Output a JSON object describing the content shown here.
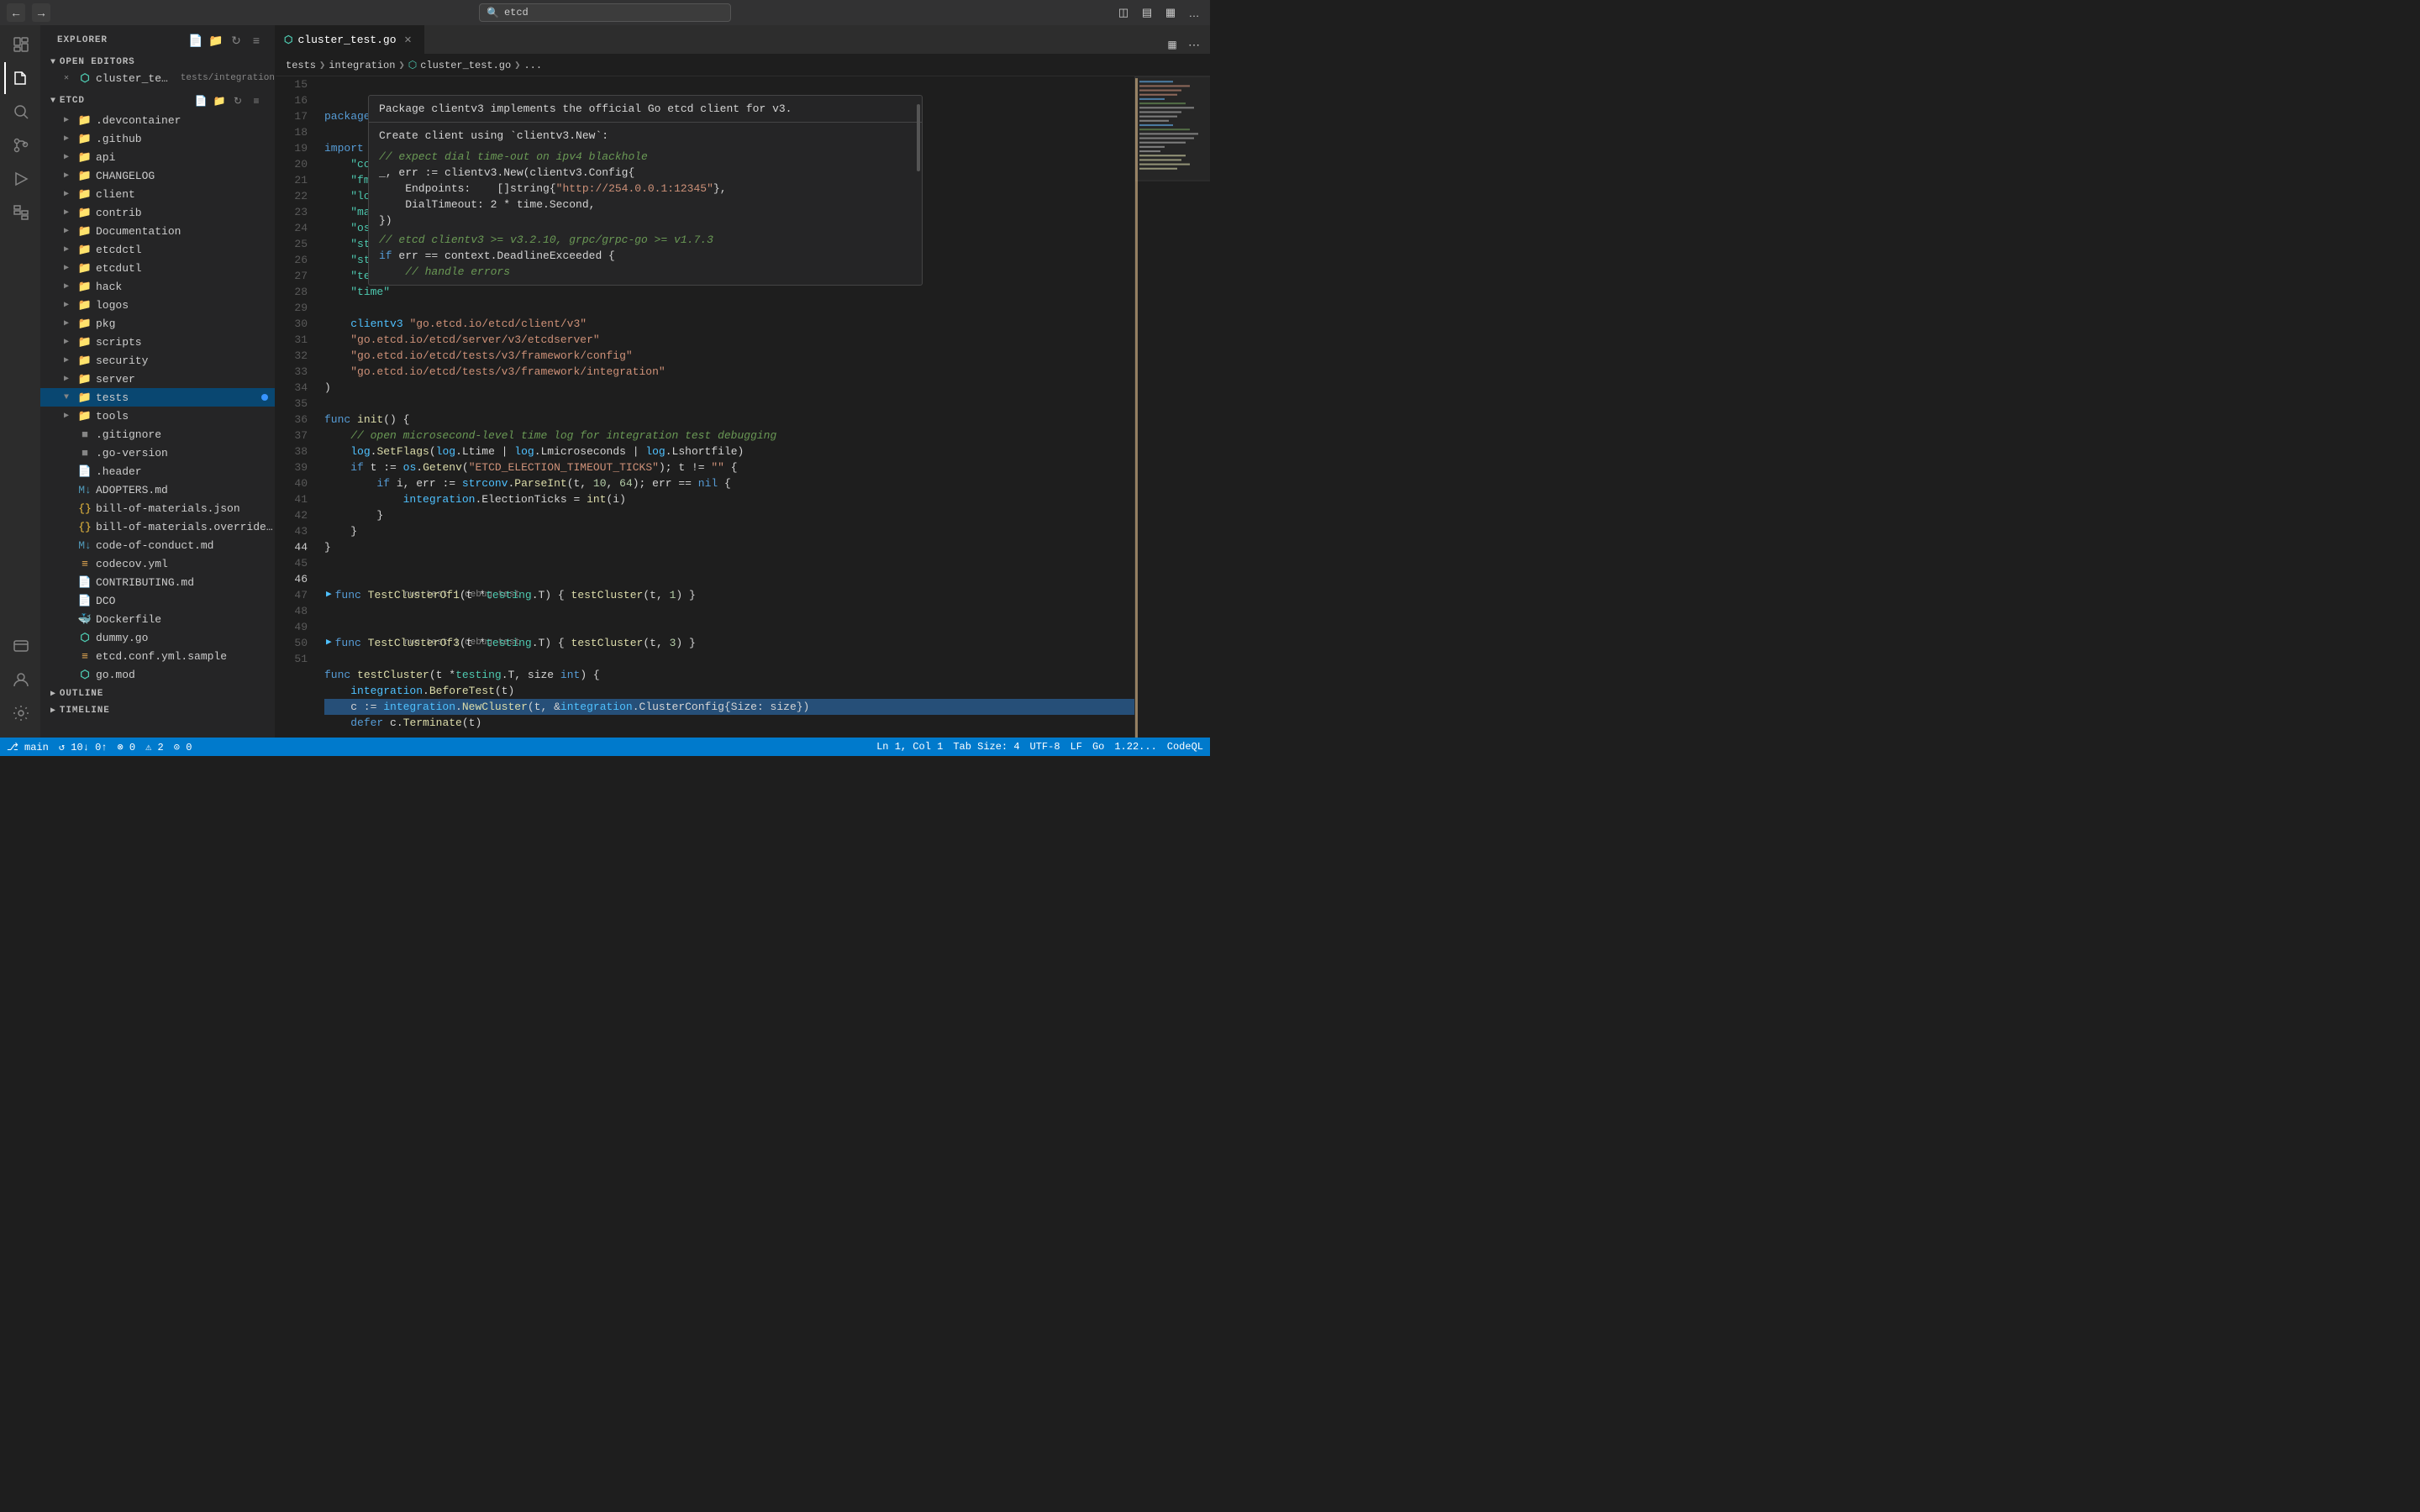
{
  "titlebar": {
    "search_value": "etcd",
    "search_placeholder": "etcd"
  },
  "tabs": [
    {
      "id": "cluster_test",
      "icon": "go",
      "label": "cluster_test.go",
      "active": true,
      "closable": true
    }
  ],
  "breadcrumb": [
    "tests",
    "integration",
    "cluster_test.go",
    "..."
  ],
  "sidebar": {
    "explorer_label": "EXPLORER",
    "sections": {
      "open_editors": "OPEN EDITORS",
      "etcd": "ETCD",
      "outline": "OUTLINE",
      "timeline": "TIMELINE"
    },
    "open_editors_items": [
      {
        "label": "cluster_test.go",
        "sub": "tests/integration",
        "modified": false
      }
    ],
    "tree_items": [
      {
        "label": ".devcontainer",
        "type": "folder",
        "indent": 1
      },
      {
        "label": ".github",
        "type": "folder",
        "indent": 1
      },
      {
        "label": "api",
        "type": "folder",
        "indent": 1
      },
      {
        "label": "CHANGELOG",
        "type": "folder",
        "indent": 1
      },
      {
        "label": "client",
        "type": "folder-blue",
        "indent": 1
      },
      {
        "label": "contrib",
        "type": "folder-blue",
        "indent": 1
      },
      {
        "label": "Documentation",
        "type": "folder-blue",
        "indent": 1
      },
      {
        "label": "etcdctl",
        "type": "folder-blue",
        "indent": 1
      },
      {
        "label": "etcdutl",
        "type": "folder-blue",
        "indent": 1
      },
      {
        "label": "hack",
        "type": "folder",
        "indent": 1
      },
      {
        "label": "logos",
        "type": "folder-blue",
        "indent": 1
      },
      {
        "label": "pkg",
        "type": "folder-blue",
        "indent": 1
      },
      {
        "label": "scripts",
        "type": "folder-blue",
        "indent": 1
      },
      {
        "label": "security",
        "type": "folder",
        "indent": 1
      },
      {
        "label": "server",
        "type": "folder",
        "indent": 1
      },
      {
        "label": "tests",
        "type": "folder-open-green",
        "indent": 1,
        "selected": true,
        "badge": true
      },
      {
        "label": "tools",
        "type": "folder-blue",
        "indent": 1
      },
      {
        "label": ".gitignore",
        "type": "dot",
        "indent": 1
      },
      {
        "label": ".go-version",
        "type": "dot",
        "indent": 1
      },
      {
        "label": ".header",
        "type": "file",
        "indent": 1
      },
      {
        "label": "ADOPTERS.md",
        "type": "md",
        "indent": 1
      },
      {
        "label": "bill-of-materials.json",
        "type": "json",
        "indent": 1
      },
      {
        "label": "bill-of-materials.override.json",
        "type": "json",
        "indent": 1
      },
      {
        "label": "code-of-conduct.md",
        "type": "md",
        "indent": 1
      },
      {
        "label": "codecov.yml",
        "type": "yaml",
        "indent": 1
      },
      {
        "label": "CONTRIBUTING.md",
        "type": "file",
        "indent": 1
      },
      {
        "label": "DCO",
        "type": "file",
        "indent": 1
      },
      {
        "label": "Dockerfile",
        "type": "docker",
        "indent": 1
      },
      {
        "label": "dummy.go",
        "type": "go",
        "indent": 1
      },
      {
        "label": "etcd.conf.yml.sample",
        "type": "yaml",
        "indent": 1
      },
      {
        "label": "go.mod",
        "type": "go",
        "indent": 1
      }
    ]
  },
  "code": {
    "tooltip": {
      "header": "Package clientv3 implements the official Go etcd client for v3.",
      "subheader": "Create client using `clientv3.New`:",
      "comment_line": "// expect dial time-out on ipv4 blackhole",
      "code_lines": [
        "_, err := clientv3.New(clientv3.Config{",
        "    Endpoints:    []string{\"http://254.0.0.1:12345\"},",
        "    DialTimeout: 2 * time.Second,",
        "})",
        "",
        "// etcd clientv3 >= v3.2.10, grpc/grpc-go >= v1.7.3",
        "if err == context.DeadlineExceeded {",
        "    // handle errors"
      ]
    },
    "lines": [
      {
        "num": 15,
        "content": "package integration",
        "tokens": [
          {
            "t": "kw",
            "v": "package"
          },
          {
            "t": "plain",
            "v": " integration"
          }
        ]
      },
      {
        "num": 16,
        "content": "",
        "tokens": []
      },
      {
        "num": 17,
        "content": "import (",
        "tokens": [
          {
            "t": "kw",
            "v": "import"
          },
          {
            "t": "plain",
            "v": " ("
          }
        ]
      },
      {
        "num": 18,
        "content": "\t\"context\"",
        "tokens": [
          {
            "t": "plain",
            "v": "\t"
          },
          {
            "t": "str-import",
            "v": "\"context\""
          }
        ]
      },
      {
        "num": 19,
        "content": "\t\"fmt\"",
        "tokens": [
          {
            "t": "plain",
            "v": "\t"
          },
          {
            "t": "str-import",
            "v": "\"fmt\""
          }
        ]
      },
      {
        "num": 20,
        "content": "\t\"log\"",
        "tokens": [
          {
            "t": "plain",
            "v": "\t"
          },
          {
            "t": "str-import",
            "v": "\"log\""
          }
        ]
      },
      {
        "num": 21,
        "content": "\t\"math/ran...",
        "tokens": [
          {
            "t": "plain",
            "v": "\t"
          },
          {
            "t": "str-import",
            "v": "\"math/ran...\""
          }
        ]
      },
      {
        "num": 22,
        "content": "\t\"os\"",
        "tokens": [
          {
            "t": "plain",
            "v": "\t"
          },
          {
            "t": "str-import",
            "v": "\"os\""
          }
        ]
      },
      {
        "num": 23,
        "content": "\t\"strconv\"",
        "tokens": [
          {
            "t": "plain",
            "v": "\t"
          },
          {
            "t": "str-import",
            "v": "\"strconv\""
          }
        ]
      },
      {
        "num": 24,
        "content": "\t\"strings\"",
        "tokens": [
          {
            "t": "plain",
            "v": "\t"
          },
          {
            "t": "str-import",
            "v": "\"strings\""
          }
        ]
      },
      {
        "num": 25,
        "content": "\t\"testing\"",
        "tokens": [
          {
            "t": "plain",
            "v": "\t"
          },
          {
            "t": "str-import",
            "v": "\"testing\""
          }
        ]
      },
      {
        "num": 26,
        "content": "\t\"time\"",
        "tokens": [
          {
            "t": "plain",
            "v": "\t"
          },
          {
            "t": "str-import",
            "v": "\"time\""
          }
        ]
      },
      {
        "num": 27,
        "content": "",
        "tokens": []
      },
      {
        "num": 28,
        "content": "\tclientv3 \"go.etcd.io/etcd/client/v3\"",
        "tokens": [
          {
            "t": "plain",
            "v": "\t"
          },
          {
            "t": "pkg",
            "v": "clientv3"
          },
          {
            "t": "plain",
            "v": " "
          },
          {
            "t": "str",
            "v": "\"go.etcd.io/etcd/client/v3\""
          }
        ]
      },
      {
        "num": 29,
        "content": "\t\"go.etcd.io/etcd/server/v3/etcdserver\"",
        "tokens": [
          {
            "t": "plain",
            "v": "\t"
          },
          {
            "t": "str",
            "v": "\"go.etcd.io/etcd/server/v3/etcdserver\""
          }
        ]
      },
      {
        "num": 30,
        "content": "\t\"go.etcd.io/etcd/tests/v3/framework/config\"",
        "tokens": [
          {
            "t": "plain",
            "v": "\t"
          },
          {
            "t": "str",
            "v": "\"go.etcd.io/etcd/tests/v3/framework/config\""
          }
        ]
      },
      {
        "num": 31,
        "content": "\t\"go.etcd.io/etcd/tests/v3/framework/integration\"",
        "tokens": [
          {
            "t": "plain",
            "v": "\t"
          },
          {
            "t": "str",
            "v": "\"go.etcd.io/etcd/tests/v3/framework/integration\""
          }
        ]
      },
      {
        "num": 32,
        "content": ")",
        "tokens": [
          {
            "t": "plain",
            "v": ")"
          }
        ]
      },
      {
        "num": 33,
        "content": "",
        "tokens": []
      },
      {
        "num": 34,
        "content": "func init() {",
        "tokens": [
          {
            "t": "kw",
            "v": "func"
          },
          {
            "t": "plain",
            "v": " "
          },
          {
            "t": "fn",
            "v": "init"
          },
          {
            "t": "plain",
            "v": "() {"
          }
        ]
      },
      {
        "num": 35,
        "content": "\t// open microsecond-level time log for integration test debugging",
        "tokens": [
          {
            "t": "comment",
            "v": "\t// open microsecond-level time log for integration test debugging"
          }
        ]
      },
      {
        "num": 36,
        "content": "\tlog.SetFlags(log.Ltime | log.Lmicroseconds | log.Lshortfile)",
        "tokens": [
          {
            "t": "plain",
            "v": "\t"
          },
          {
            "t": "pkg",
            "v": "log"
          },
          {
            "t": "plain",
            "v": "."
          },
          {
            "t": "fn",
            "v": "SetFlags"
          },
          {
            "t": "plain",
            "v": "("
          },
          {
            "t": "pkg",
            "v": "log"
          },
          {
            "t": "plain",
            "v": ".Ltime | "
          },
          {
            "t": "pkg",
            "v": "log"
          },
          {
            "t": "plain",
            "v": ".Lmicroseconds | "
          },
          {
            "t": "pkg",
            "v": "log"
          },
          {
            "t": "plain",
            "v": ".Lshortfile)"
          }
        ]
      },
      {
        "num": 37,
        "content": "\tif t := os.Getenv(\"ETCD_ELECTION_TIMEOUT_TICKS\"); t != \"\" {",
        "tokens": [
          {
            "t": "plain",
            "v": "\t"
          },
          {
            "t": "kw",
            "v": "if"
          },
          {
            "t": "plain",
            "v": " t := "
          },
          {
            "t": "pkg",
            "v": "os"
          },
          {
            "t": "plain",
            "v": "."
          },
          {
            "t": "fn",
            "v": "Getenv"
          },
          {
            "t": "plain",
            "v": "("
          },
          {
            "t": "str",
            "v": "\"ETCD_ELECTION_TIMEOUT_TICKS\""
          },
          {
            "t": "plain",
            "v": "); t != "
          },
          {
            "t": "str",
            "v": "\"\""
          },
          {
            "t": "plain",
            "v": " {"
          }
        ]
      },
      {
        "num": 38,
        "content": "\t\tif i, err := strconv.ParseInt(t, 10, 64); err == nil {",
        "tokens": [
          {
            "t": "plain",
            "v": "\t\t"
          },
          {
            "t": "kw",
            "v": "if"
          },
          {
            "t": "plain",
            "v": " i, err := "
          },
          {
            "t": "pkg",
            "v": "strconv"
          },
          {
            "t": "plain",
            "v": "."
          },
          {
            "t": "fn",
            "v": "ParseInt"
          },
          {
            "t": "plain",
            "v": "(t, "
          },
          {
            "t": "num",
            "v": "10"
          },
          {
            "t": "plain",
            "v": ", "
          },
          {
            "t": "num",
            "v": "64"
          },
          {
            "t": "plain",
            "v": "); err == "
          },
          {
            "t": "kw",
            "v": "nil"
          },
          {
            "t": "plain",
            "v": " {"
          }
        ]
      },
      {
        "num": 39,
        "content": "\t\t\tintegration.ElectionTicks = int(i)",
        "tokens": [
          {
            "t": "plain",
            "v": "\t\t\t"
          },
          {
            "t": "pkg",
            "v": "integration"
          },
          {
            "t": "plain",
            "v": ".ElectionTicks = "
          },
          {
            "t": "fn",
            "v": "int"
          },
          {
            "t": "plain",
            "v": "(i)"
          }
        ]
      },
      {
        "num": 40,
        "content": "\t\t}",
        "tokens": [
          {
            "t": "plain",
            "v": "\t\t}"
          }
        ]
      },
      {
        "num": 41,
        "content": "\t}",
        "tokens": [
          {
            "t": "plain",
            "v": "\t}"
          }
        ]
      },
      {
        "num": 42,
        "content": "}",
        "tokens": [
          {
            "t": "plain",
            "v": "}"
          }
        ]
      },
      {
        "num": 43,
        "content": "",
        "tokens": []
      },
      {
        "num": 44,
        "content": "func TestClusterOf1(t *testing.T) { testCluster(t, 1) }",
        "tokens": [
          {
            "t": "kw",
            "v": "func"
          },
          {
            "t": "plain",
            "v": " "
          },
          {
            "t": "fn",
            "v": "TestClusterOf1"
          },
          {
            "t": "plain",
            "v": "(t *"
          },
          {
            "t": "type",
            "v": "testing"
          },
          {
            "t": "plain",
            "v": ".T) { "
          },
          {
            "t": "fn",
            "v": "testCluster"
          },
          {
            "t": "plain",
            "v": "(t, "
          },
          {
            "t": "num",
            "v": "1"
          },
          {
            "t": "plain",
            "v": ") }"
          }
        ],
        "run_test": true
      },
      {
        "num": 45,
        "content": "",
        "tokens": []
      },
      {
        "num": 46,
        "content": "func TestClusterOf3(t *testing.T) { testCluster(t, 3) }",
        "tokens": [
          {
            "t": "kw",
            "v": "func"
          },
          {
            "t": "plain",
            "v": " "
          },
          {
            "t": "fn",
            "v": "TestClusterOf3"
          },
          {
            "t": "plain",
            "v": "(t *"
          },
          {
            "t": "type",
            "v": "testing"
          },
          {
            "t": "plain",
            "v": ".T) { "
          },
          {
            "t": "fn",
            "v": "testCluster"
          },
          {
            "t": "plain",
            "v": "(t, "
          },
          {
            "t": "num",
            "v": "3"
          },
          {
            "t": "plain",
            "v": ") }"
          }
        ],
        "run_test": true
      },
      {
        "num": 47,
        "content": "",
        "tokens": []
      },
      {
        "num": 48,
        "content": "func testCluster(t *testing.T, size int) {",
        "tokens": [
          {
            "t": "kw",
            "v": "func"
          },
          {
            "t": "plain",
            "v": " "
          },
          {
            "t": "fn",
            "v": "testCluster"
          },
          {
            "t": "plain",
            "v": "(t *"
          },
          {
            "t": "type",
            "v": "testing"
          },
          {
            "t": "plain",
            "v": ".T, size "
          },
          {
            "t": "kw",
            "v": "int"
          },
          {
            "t": "plain",
            "v": ") {"
          }
        ]
      },
      {
        "num": 49,
        "content": "\tintegration.BeforeTest(t)",
        "tokens": [
          {
            "t": "plain",
            "v": "\t"
          },
          {
            "t": "pkg",
            "v": "integration"
          },
          {
            "t": "plain",
            "v": "."
          },
          {
            "t": "fn",
            "v": "BeforeTest"
          },
          {
            "t": "plain",
            "v": "(t)"
          }
        ]
      },
      {
        "num": 50,
        "content": "\tc := integration.NewCluster(t, &integration.ClusterConfig{Size: size})",
        "tokens": [
          {
            "t": "plain",
            "v": "\tc := "
          },
          {
            "t": "pkg",
            "v": "integration"
          },
          {
            "t": "plain",
            "v": "."
          },
          {
            "t": "fn",
            "v": "NewCluster"
          },
          {
            "t": "plain",
            "v": "(t, &"
          },
          {
            "t": "pkg",
            "v": "integration"
          },
          {
            "t": "plain",
            "v": ".ClusterConfig{Size: size})"
          }
        ]
      },
      {
        "num": 51,
        "content": "\tdefer c.Terminate(t)",
        "tokens": [
          {
            "t": "plain",
            "v": "\t"
          },
          {
            "t": "kw",
            "v": "defer"
          },
          {
            "t": "plain",
            "v": " c."
          },
          {
            "t": "fn",
            "v": "Terminate"
          },
          {
            "t": "plain",
            "v": "(t)"
          }
        ]
      }
    ]
  },
  "status_bar": {
    "branch": "main",
    "sync": "↺ 10↓ 0↑",
    "errors": "⊗ 0",
    "warnings": "⚠ 2",
    "no_config": "⊙ 0",
    "position": "Ln 1, Col 1",
    "tab_size": "Tab Size: 4",
    "encoding": "UTF-8",
    "line_ending": "LF",
    "language": "Go",
    "go_version": "1.22...",
    "codeql": "CodeQL"
  },
  "run_test_labels": {
    "line_44": "run test | debug test",
    "line_46": "run test | debug test"
  }
}
